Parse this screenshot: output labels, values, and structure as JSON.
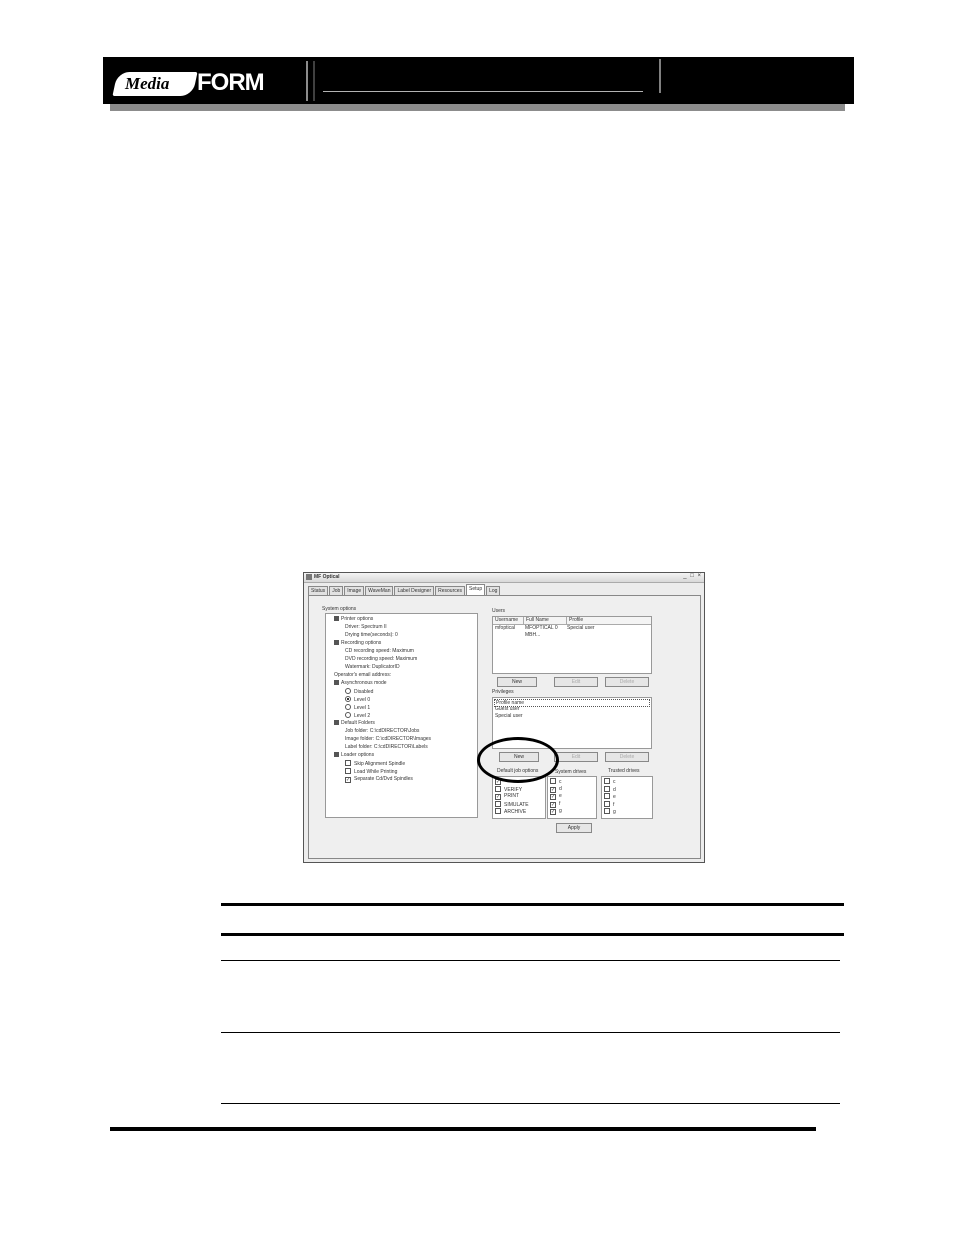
{
  "logo": {
    "media": "Media",
    "form": "FORM"
  },
  "window": {
    "title": "MF Optical",
    "controls": "_ □ ×",
    "tabs": [
      "Status",
      "Job",
      "Image",
      "WaveMan",
      "Label Designer",
      "Resources",
      "Setup",
      "Log"
    ],
    "active_tab": "Setup"
  },
  "system_options": {
    "label": "System options",
    "items": [
      {
        "text": "Printer options",
        "kind": "folder",
        "indent": 0
      },
      {
        "text": "Driver: Spectrum II",
        "kind": "leaf",
        "indent": 1
      },
      {
        "text": "Drying time(seconds): 0",
        "kind": "leaf",
        "indent": 1
      },
      {
        "text": "Recording options",
        "kind": "folder",
        "indent": 0
      },
      {
        "text": "CD recording speed: Maximum",
        "kind": "leaf",
        "indent": 1
      },
      {
        "text": "DVD recording speed: Maximum",
        "kind": "leaf",
        "indent": 1
      },
      {
        "text": "Watermark: DuplicatorID",
        "kind": "leaf",
        "indent": 1
      },
      {
        "text": "Operator's email address:",
        "kind": "leaf",
        "indent": 0
      },
      {
        "text": "Asynchronous mode",
        "kind": "folder",
        "indent": 0
      },
      {
        "text": "Disabled",
        "kind": "radio",
        "checked": false,
        "indent": 1
      },
      {
        "text": "Level 0",
        "kind": "radio",
        "checked": true,
        "indent": 1
      },
      {
        "text": "Level 1",
        "kind": "radio",
        "checked": false,
        "indent": 1
      },
      {
        "text": "Level 2",
        "kind": "radio",
        "checked": false,
        "indent": 1
      },
      {
        "text": "Default Folders",
        "kind": "folder",
        "indent": 0
      },
      {
        "text": "Job folder: C:\\cdDIRECTOR\\Jobs",
        "kind": "leaf",
        "indent": 1
      },
      {
        "text": "Image folder: C:\\cdDIRECTOR\\Images",
        "kind": "leaf",
        "indent": 1
      },
      {
        "text": "Label folder: C:\\cdDIRECTOR\\Labels",
        "kind": "leaf",
        "indent": 1
      },
      {
        "text": "Loader options",
        "kind": "folder",
        "indent": 0
      },
      {
        "text": "Skip Alignment Spindle",
        "kind": "check",
        "checked": false,
        "indent": 1
      },
      {
        "text": "Load While Printing",
        "kind": "check",
        "checked": false,
        "indent": 1
      },
      {
        "text": "Separate Cd/Dvd Spindles",
        "kind": "check",
        "checked": true,
        "indent": 1
      }
    ]
  },
  "users": {
    "label": "Users",
    "columns": [
      "Username",
      "Full Name",
      "Profile"
    ],
    "rows": [
      [
        "mfoptical",
        "MFOPTICAL 0 MBH...",
        "Special user"
      ]
    ],
    "buttons": {
      "new": "New",
      "edit": "Edit",
      "delete": "Delete"
    }
  },
  "privileges": {
    "label": "Privileges",
    "items": [
      "Profile name",
      "Guest user",
      "Special user"
    ],
    "buttons": {
      "new": "New",
      "edit": "Edit",
      "delete": "Delete"
    }
  },
  "default_job_options": {
    "label": "Default job options",
    "items": [
      {
        "text": "",
        "checked": true
      },
      {
        "text": "VERIFY",
        "checked": false
      },
      {
        "text": "PRINT",
        "checked": true
      },
      {
        "text": "SIMULATE",
        "checked": false
      },
      {
        "text": "ARCHIVE",
        "checked": false
      }
    ]
  },
  "system_drives": {
    "label": "System drives",
    "items": [
      {
        "text": "c",
        "checked": false
      },
      {
        "text": "d",
        "checked": true
      },
      {
        "text": "e",
        "checked": true
      },
      {
        "text": "f",
        "checked": true
      },
      {
        "text": "g",
        "checked": true
      }
    ]
  },
  "trusted_drives": {
    "label": "Trusted drives",
    "items": [
      {
        "text": "c",
        "checked": false
      },
      {
        "text": "d",
        "checked": false
      },
      {
        "text": "e",
        "checked": false
      },
      {
        "text": "f",
        "checked": false
      },
      {
        "text": "g",
        "checked": false
      }
    ]
  },
  "apply_label": "Apply"
}
